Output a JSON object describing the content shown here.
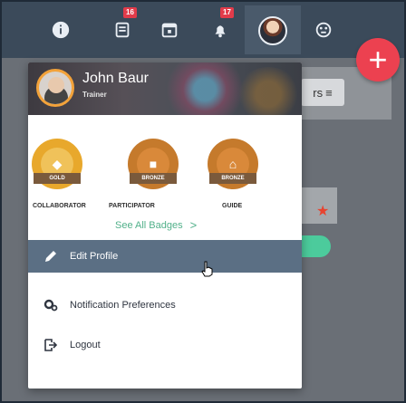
{
  "topnav": {
    "icons": [
      "info-icon",
      "news-icon",
      "calendar-icon",
      "bell-icon",
      "user-icon",
      "palette-icon"
    ],
    "news_badge": "16",
    "bell_badge": "17"
  },
  "fab": {
    "symbol": "+"
  },
  "background": {
    "sort_label": "rs"
  },
  "profile": {
    "name": "John Baur",
    "role": "Trainer"
  },
  "badges": {
    "items": [
      {
        "ribbon": "GOLD",
        "label": "COLLABORATOR",
        "color": "#e8a82c"
      },
      {
        "ribbon": "BRONZE",
        "label": "PARTICIPATOR",
        "color": "#c57a2c"
      },
      {
        "ribbon": "BRONZE",
        "label": "GUIDE",
        "color": "#c57a2c"
      }
    ],
    "see_all": "See All Badges",
    "see_all_chevron": ">"
  },
  "menu": {
    "edit_profile": "Edit Profile",
    "notification_preferences": "Notification Preferences",
    "logout": "Logout"
  },
  "colors": {
    "nav_bg": "#3b4a5a",
    "active_item": "#5b6f84",
    "accent_green": "#51b08a",
    "fab_red": "#ec4150"
  }
}
